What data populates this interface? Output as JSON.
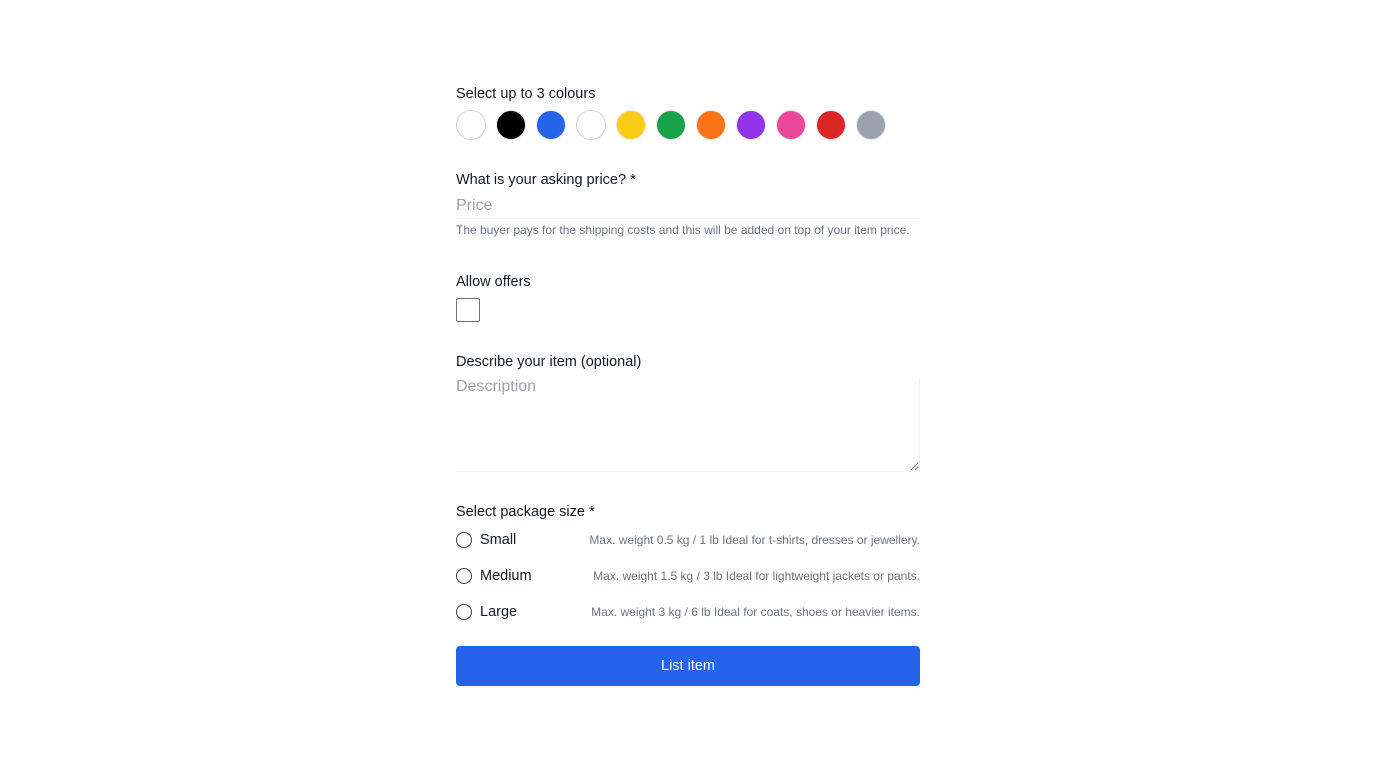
{
  "colours": {
    "label": "Select up to 3 colours",
    "swatches": [
      {
        "name": "white",
        "hex": "#ffffff"
      },
      {
        "name": "black",
        "hex": "#000000"
      },
      {
        "name": "blue",
        "hex": "#2563eb"
      },
      {
        "name": "white",
        "hex": "#ffffff"
      },
      {
        "name": "yellow",
        "hex": "#facc15"
      },
      {
        "name": "green",
        "hex": "#16a34a"
      },
      {
        "name": "orange",
        "hex": "#f97316"
      },
      {
        "name": "purple",
        "hex": "#9333ea"
      },
      {
        "name": "pink",
        "hex": "#ec4899"
      },
      {
        "name": "red",
        "hex": "#dc2626"
      },
      {
        "name": "gray",
        "hex": "#9ca3af"
      }
    ]
  },
  "price": {
    "label": "What is your asking price? *",
    "placeholder": "Price",
    "helper": "The buyer pays for the shipping costs and this will be added on top of your item price."
  },
  "offers": {
    "label": "Allow offers"
  },
  "description": {
    "label": "Describe your item (optional)",
    "placeholder": "Description"
  },
  "package": {
    "label": "Select package size *",
    "options": [
      {
        "name": "Small",
        "detail": "Max. weight 0.5 kg / 1 lb Ideal for t-shirts, dresses or jewellery."
      },
      {
        "name": "Medium",
        "detail": "Max. weight 1.5 kg / 3 lb Ideal for lightweight jackets or pants."
      },
      {
        "name": "Large",
        "detail": "Max. weight 3 kg / 6 lb Ideal for coats, shoes or heavier items."
      }
    ]
  },
  "submit": {
    "label": "List item",
    "color": "#2563eb"
  }
}
